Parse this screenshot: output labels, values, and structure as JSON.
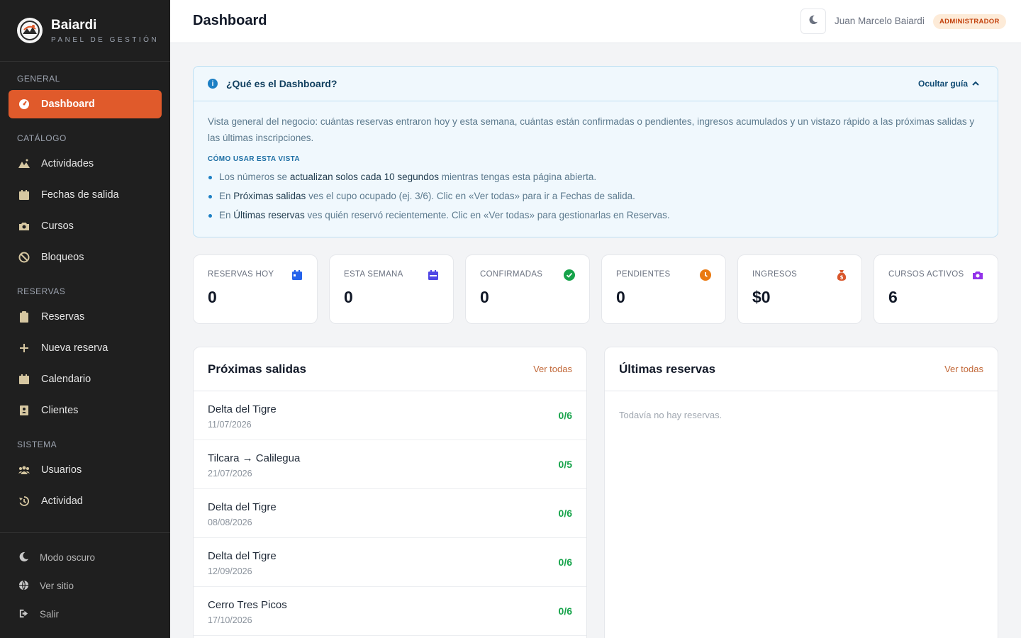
{
  "brand": {
    "name": "Baiardi",
    "subtitle": "PANEL DE GESTIÓN"
  },
  "sidebar": {
    "sections": {
      "general": "GENERAL",
      "catalogo": "CATÁLOGO",
      "reservas": "RESERVAS",
      "sistema": "SISTEMA"
    },
    "items": {
      "dashboard": "Dashboard",
      "actividades": "Actividades",
      "fechas": "Fechas de salida",
      "cursos": "Cursos",
      "bloqueos": "Bloqueos",
      "reservas": "Reservas",
      "nueva": "Nueva reserva",
      "calendario": "Calendario",
      "clientes": "Clientes",
      "usuarios": "Usuarios",
      "actividad": "Actividad"
    },
    "bottom": {
      "modo_oscuro": "Modo oscuro",
      "ver_sitio": "Ver sitio",
      "salir": "Salir"
    }
  },
  "header": {
    "title": "Dashboard",
    "user_name": "Juan Marcelo Baiardi",
    "role": "ADMINISTRADOR"
  },
  "guide": {
    "title": "¿Qué es el Dashboard?",
    "toggle": "Ocultar guía",
    "description": "Vista general del negocio: cuántas reservas entraron hoy y esta semana, cuántas están confirmadas o pendientes, ingresos acumulados y un vistazo rápido a las próximas salidas y las últimas inscripciones.",
    "howto_title": "CÓMO USAR ESTA VISTA",
    "tips": [
      {
        "pre": "Los números se ",
        "strong": "actualizan solos cada 10 segundos",
        "post": " mientras tengas esta página abierta."
      },
      {
        "pre": "En ",
        "strong": "Próximas salidas",
        "post": " ves el cupo ocupado (ej. 3/6). Clic en «Ver todas» para ir a Fechas de salida."
      },
      {
        "pre": "En ",
        "strong": "Últimas reservas",
        "post": " ves quién reservó recientemente. Clic en «Ver todas» para gestionarlas en Reservas."
      }
    ]
  },
  "stats": [
    {
      "label": "RESERVAS HOY",
      "value": "0",
      "icon": "calendar-day-icon",
      "color": "#2563eb"
    },
    {
      "label": "ESTA SEMANA",
      "value": "0",
      "icon": "calendar-week-icon",
      "color": "#4f46e5"
    },
    {
      "label": "CONFIRMADAS",
      "value": "0",
      "icon": "check-circle-icon",
      "color": "#16a34a"
    },
    {
      "label": "PENDIENTES",
      "value": "0",
      "icon": "clock-icon",
      "color": "#ea7a12"
    },
    {
      "label": "INGRESOS",
      "value": "$0",
      "icon": "money-bag-icon",
      "color": "#d9572c"
    },
    {
      "label": "CURSOS ACTIVOS",
      "value": "6",
      "icon": "camera-icon",
      "color": "#9333ea"
    }
  ],
  "proximas": {
    "title": "Próximas salidas",
    "link": "Ver todas",
    "rows": [
      {
        "name": "Delta del Tigre",
        "date": "11/07/2026",
        "count": "0/6"
      },
      {
        "name": "Tilcara → Calilegua",
        "date": "21/07/2026",
        "count": "0/5"
      },
      {
        "name": "Delta del Tigre",
        "date": "08/08/2026",
        "count": "0/6"
      },
      {
        "name": "Delta del Tigre",
        "date": "12/09/2026",
        "count": "0/6"
      },
      {
        "name": "Cerro Tres Picos",
        "date": "17/10/2026",
        "count": "0/6"
      }
    ]
  },
  "ultimas": {
    "title": "Últimas reservas",
    "link": "Ver todas",
    "empty": "Todavía no hay reservas."
  },
  "colors": {
    "accent": "#e05a2b",
    "sidebar_bg": "#1f1f1f",
    "success": "#16a34a"
  }
}
